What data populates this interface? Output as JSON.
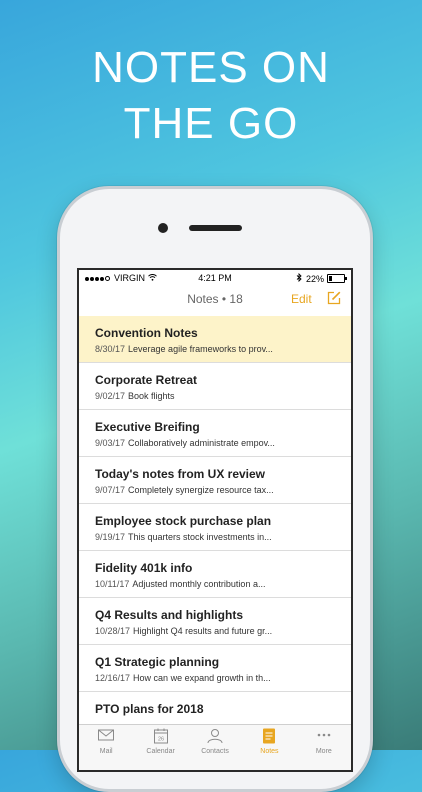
{
  "promo": {
    "line1": "NOTES ON",
    "line2": "THE GO"
  },
  "status_bar": {
    "carrier": "VIRGIN",
    "time": "4:21 PM",
    "battery": "22%",
    "battery_level": 0.22
  },
  "nav": {
    "title": "Notes • 18",
    "edit_label": "Edit",
    "compose_icon": "compose-icon"
  },
  "notes": [
    {
      "title": "Convention Notes",
      "date": "8/30/17",
      "preview": "Leverage agile frameworks to prov...",
      "selected": true
    },
    {
      "title": "Corporate Retreat",
      "date": "9/02/17",
      "preview": "Book flights"
    },
    {
      "title": "Executive Breifing",
      "date": "9/03/17",
      "preview": "Collaboratively administrate empov..."
    },
    {
      "title": "Today's notes from UX review",
      "date": "9/07/17",
      "preview": "Completely synergize resource tax..."
    },
    {
      "title": "Employee stock purchase plan",
      "date": "9/19/17",
      "preview": "This quarters stock investments in..."
    },
    {
      "title": "Fidelity 401k info",
      "date": "10/11/17",
      "preview": "Adjusted monthly contribution a..."
    },
    {
      "title": "Q4 Results and highlights",
      "date": "10/28/17",
      "preview": "Highlight Q4 results and future gr..."
    },
    {
      "title": "Q1 Strategic planning",
      "date": "12/16/17",
      "preview": "How can we expand growth in th..."
    },
    {
      "title": "PTO plans for 2018",
      "date": "",
      "preview": ""
    }
  ],
  "tabs": [
    {
      "label": "Mail",
      "icon": "mail-icon"
    },
    {
      "label": "Calendar",
      "icon": "calendar-icon",
      "badge": "26"
    },
    {
      "label": "Contacts",
      "icon": "contacts-icon"
    },
    {
      "label": "Notes",
      "icon": "notes-icon",
      "active": true
    },
    {
      "label": "More",
      "icon": "more-icon"
    }
  ],
  "colors": {
    "accent": "#e8a620",
    "selected_row": "#fdf3c9"
  }
}
